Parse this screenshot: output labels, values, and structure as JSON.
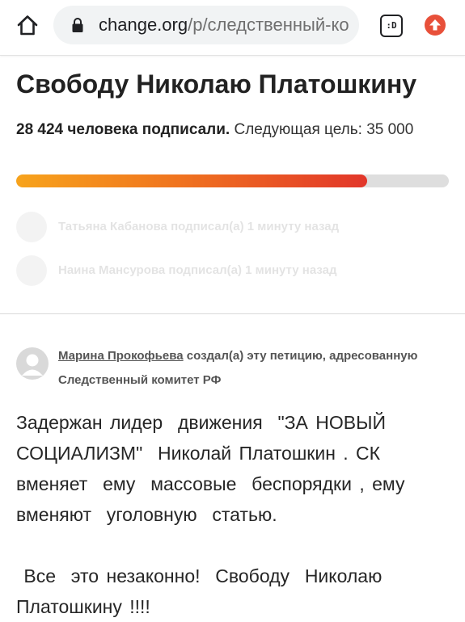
{
  "browser": {
    "url_domain": "change.org",
    "url_path": "/p/следственный-ко",
    "tab_label": ":D",
    "icons": {
      "home": "home-icon",
      "lock": "lock-icon",
      "tabs": "tab-switcher-icon",
      "update": "upload-icon"
    }
  },
  "petition": {
    "title": "Свободу Николаю Платошкину",
    "signed_count": "28 424 человека подписали.",
    "next_goal_text": " Следующая цель: 35 000",
    "progress_fraction": 0.8121
  },
  "recent_signers": [
    {
      "text": "Татьяна Кабанова подписал(а) 1 минуту назад"
    },
    {
      "text": "Наина Мансурова подписал(а) 1 минуту назад"
    }
  ],
  "creator": {
    "name": "Марина Прокофьева",
    "action": " создал(а) эту петицию, адресованную Следственный комитет РФ"
  },
  "body": {
    "paragraph1": "Задержан лидер  движения  \"ЗА НОВЫЙ СОЦИАЛИЗМ\"  Николай Платошкин . СК вменяет  ему  массовые  беспорядки , ему вменяют  уголовную  статью.",
    "paragraph2": " Все  это незаконно!  Свободу  Николаю Платошкину !!!!"
  },
  "colors": {
    "progress_start": "#f7a31c",
    "progress_end": "#e2362a",
    "track": "#dedede",
    "update_icon": "#e8503a"
  }
}
